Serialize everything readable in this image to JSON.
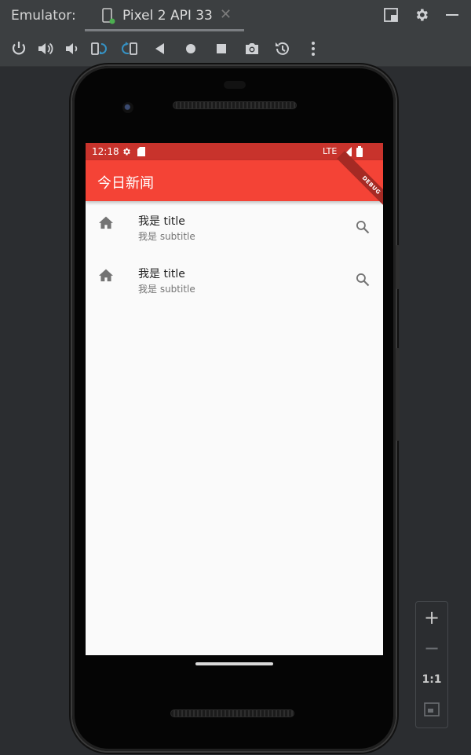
{
  "ide": {
    "emulator_label": "Emulator:",
    "tab_name": "Pixel 2 API 33",
    "tab_close": "✕",
    "colors": {
      "bg": "#2b2d30",
      "panel": "#3c3f41",
      "icon": "#cfd1d4",
      "accent": "#3592c4"
    },
    "toolbar_icons": [
      "power-icon",
      "volume-up-icon",
      "volume-down-icon",
      "rotate-left-icon",
      "rotate-right-icon",
      "back-icon",
      "home-icon",
      "overview-icon",
      "camera-icon",
      "snapshot-icon",
      "more-icon"
    ],
    "zoom": {
      "in": "+",
      "out": "−",
      "ratio": "1:1"
    }
  },
  "device": {
    "status_time": "12:18",
    "network": "LTE",
    "debug_banner": "DEBUG",
    "app_title": "今日新闻",
    "colors": {
      "primary": "#f44336",
      "status": "#c8332c",
      "background": "#fafafa"
    },
    "list": [
      {
        "title": "我是 title",
        "subtitle": "我是 subtitle",
        "leading_icon": "home-icon",
        "trailing_icon": "search-icon"
      },
      {
        "title": "我是 title",
        "subtitle": "我是 subtitle",
        "leading_icon": "home-icon",
        "trailing_icon": "search-icon"
      }
    ]
  }
}
